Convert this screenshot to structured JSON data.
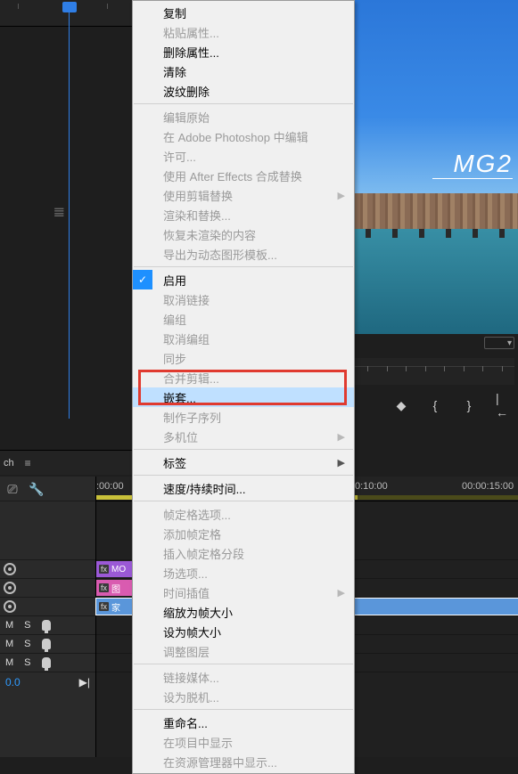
{
  "panel": {
    "tab": "ch",
    "menu_glyph": "≡"
  },
  "preview": {
    "title": "MG2",
    "zoom_caret": "▾"
  },
  "transport": {
    "marker": "◆",
    "in_bracket": "{",
    "out_bracket": "}",
    "prev_edit": "|←",
    "next_edit": "→|"
  },
  "tools": {
    "snap": "⎚",
    "wrench": "🔧"
  },
  "timecode": {
    "value": "0.0",
    "skip": "▶|"
  },
  "ruler": {
    "t0": ":00:00",
    "t10": "0:10:00",
    "t15": "00:00:15:00"
  },
  "tracks": {
    "v3": {
      "fx": "fx",
      "label": "MO"
    },
    "v2": {
      "fx": "fx",
      "label": "图"
    },
    "v1": {
      "fx": "fx",
      "label": "家"
    },
    "a": {
      "mute": "M",
      "solo": "S"
    }
  },
  "glyph": {
    "inout": "𝌆"
  },
  "ctx": {
    "copy": "复制",
    "paste_attrs": "粘贴属性...",
    "delete_attrs": "删除属性...",
    "clear": "清除",
    "ripple_delete": "波纹删除",
    "edit_original": "编辑原始",
    "edit_in_ps": "在 Adobe Photoshop 中编辑",
    "license": "许可...",
    "replace_ae": "使用 After Effects 合成替换",
    "replace_clip": "使用剪辑替换",
    "render_replace": "渲染和替换...",
    "restore_unrendered": "恢复未渲染的内容",
    "export_mogrt": "导出为动态图形模板...",
    "enable": "启用",
    "unlink": "取消链接",
    "group": "编组",
    "ungroup": "取消编组",
    "sync": "同步",
    "merge": "合并剪辑...",
    "nest": "嵌套...",
    "subsequence": "制作子序列",
    "multicam": "多机位",
    "label": "标签",
    "speed": "速度/持续时间...",
    "frame_hold_opts": "帧定格选项...",
    "add_frame_hold": "添加帧定格",
    "insert_hold_seg": "插入帧定格分段",
    "field_opts": "场选项...",
    "time_interp": "时间插值",
    "scale_frame": "缩放为帧大小",
    "set_frame": "设为帧大小",
    "adjustment": "调整图层",
    "link_media": "链接媒体...",
    "make_offline": "设为脱机...",
    "rename": "重命名...",
    "reveal_project": "在项目中显示",
    "reveal_explorer": "在资源管理器中显示..."
  }
}
